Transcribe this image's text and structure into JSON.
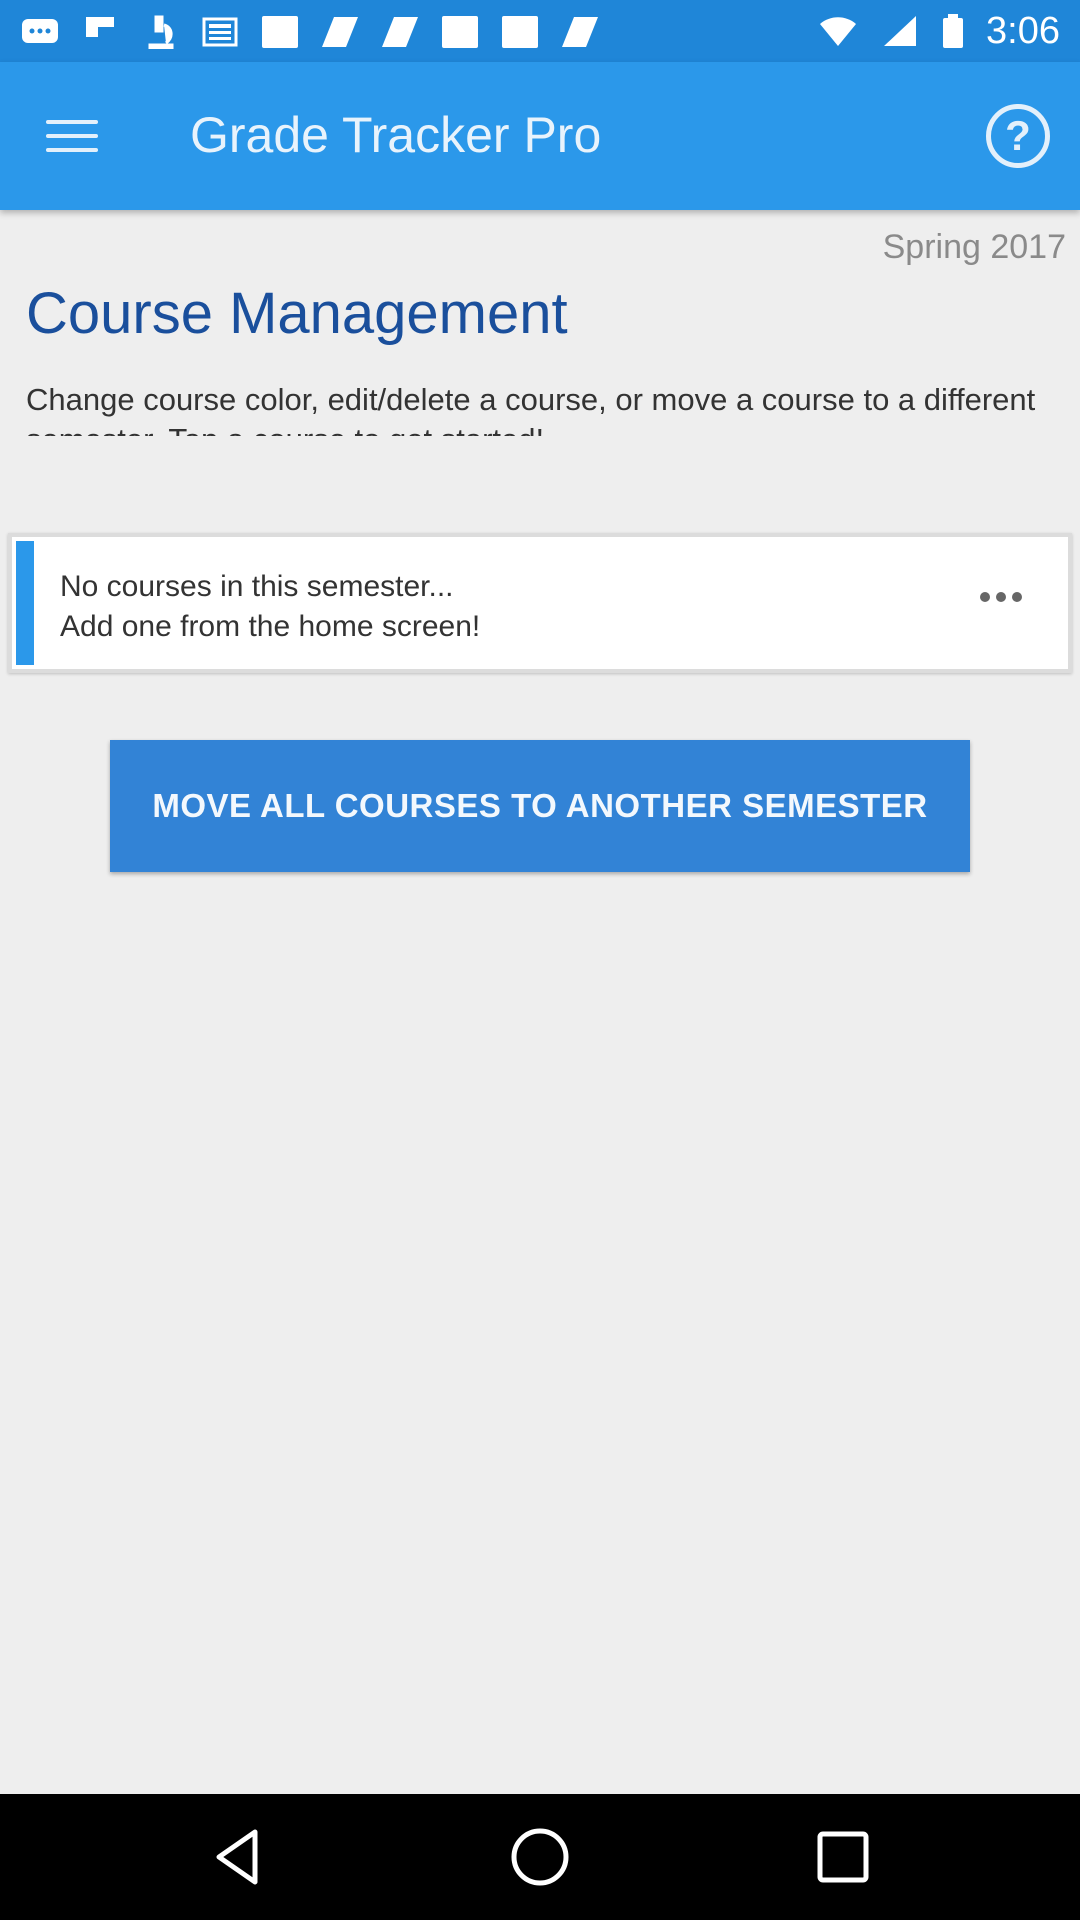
{
  "status_bar": {
    "time": "3:06",
    "icons": [
      "chat-bubble-icon",
      "flipboard-icon",
      "microscope-icon",
      "news-icon",
      "blank-square-icon",
      "parallelogram-icon",
      "parallelogram-icon",
      "blank-square-icon",
      "blank-square-icon",
      "parallelogram-icon"
    ],
    "status_icons": [
      "wifi-icon",
      "signal-icon",
      "battery-icon"
    ]
  },
  "app_bar": {
    "title": "Grade Tracker Pro",
    "menu_icon": "hamburger-menu-icon",
    "help_icon": "help-circle-icon",
    "help_glyph": "?"
  },
  "main": {
    "semester": "Spring 2017",
    "title": "Course Management",
    "description": "Change course color, edit/delete a course, or move a course to a different semester. Tap a course to get started!",
    "course_card": {
      "line1": "No courses in this semester...",
      "line2": "Add one from the home screen!",
      "stripe_color": "#2b98ea",
      "more_icon": "more-horizontal-icon"
    },
    "move_all_button": "MOVE ALL COURSES TO ANOTHER SEMESTER"
  },
  "colors": {
    "app_bar": "#2b98ea",
    "status_bar": "#1f86d8",
    "title_blue": "#1a4f9c",
    "button_blue": "#3283d6"
  },
  "nav_bar": {
    "icons": [
      "back-icon",
      "home-icon",
      "recents-icon"
    ]
  }
}
